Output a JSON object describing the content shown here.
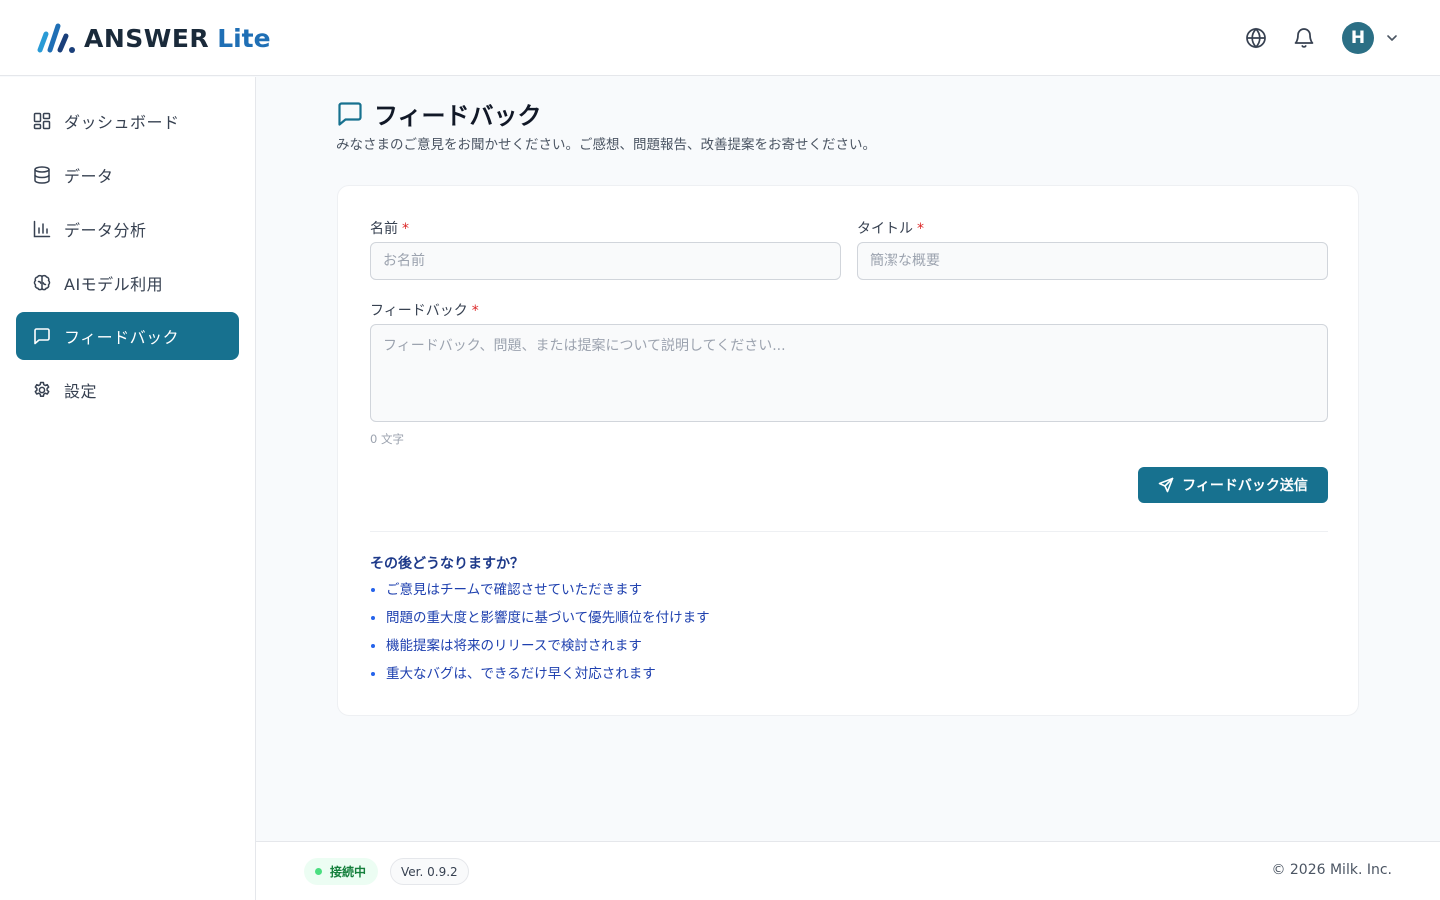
{
  "header": {
    "logo_text": "ANSWER",
    "logo_suffix": "Lite",
    "language_icon": "globe-icon",
    "notifications_icon": "bell-icon",
    "avatar_initial": "H",
    "avatar_menu_icon": "chevron-down-icon"
  },
  "sidebar": {
    "items": [
      {
        "label": "ダッシュボード",
        "icon": "dashboard-icon",
        "active": false
      },
      {
        "label": "データ",
        "icon": "database-icon",
        "active": false
      },
      {
        "label": "データ分析",
        "icon": "bar-chart-icon",
        "active": false
      },
      {
        "label": "AIモデル利用",
        "icon": "brain-icon",
        "active": false
      },
      {
        "label": "フィードバック",
        "icon": "message-square-icon",
        "active": true
      },
      {
        "label": "設定",
        "icon": "gear-icon",
        "active": false
      }
    ]
  },
  "page": {
    "title": "フィードバック",
    "title_icon": "message-square-icon",
    "subtitle": "みなさまのご意見をお聞かせください。ご感想、問題報告、改善提案をお寄せください。"
  },
  "form": {
    "name_label": "名前",
    "name_placeholder": "お名前",
    "name_value": "",
    "title_label": "タイトル",
    "title_placeholder": "簡潔な概要",
    "title_value": "",
    "feedback_label": "フィードバック",
    "feedback_placeholder": "フィードバック、問題、または提案について説明してください...",
    "feedback_value": "",
    "required_mark": "*",
    "char_count": "0 文字",
    "submit_label": "フィードバック送信",
    "submit_icon": "send-icon"
  },
  "info": {
    "title": "その後どうなりますか？",
    "items": [
      "ご意見はチームで確認させていただきます",
      "問題の重大度と影響度に基づいて優先順位を付けます",
      "機能提案は将来のリリースで検討されます",
      "重大なバグは、できるだけ早く対応されます"
    ]
  },
  "footer": {
    "status": "接続中",
    "version": "Ver. 0.9.2",
    "copyright": "© 2026 Milk. Inc."
  },
  "colors": {
    "accent": "#17718f",
    "logo_lite": "#1f6fb5",
    "status_green": "#15803d",
    "required_red": "#dc2626",
    "info_blue": "#1e40af"
  }
}
